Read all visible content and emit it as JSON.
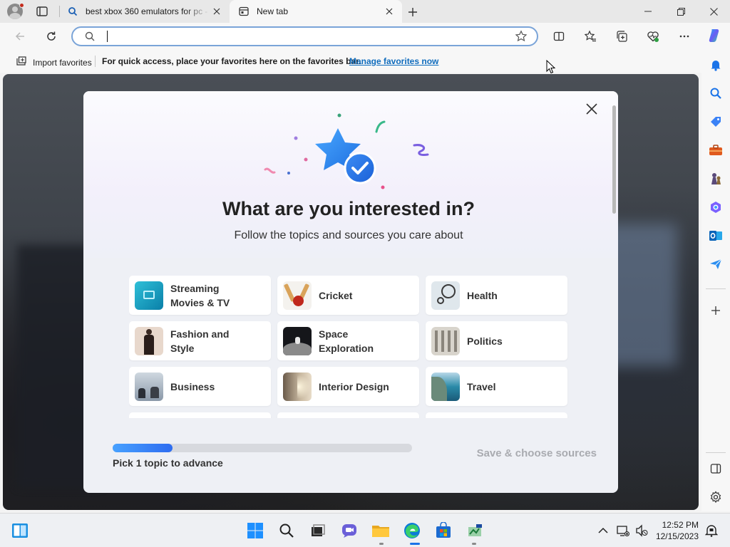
{
  "browser": {
    "tabs": [
      {
        "label": "best xbox 360 emulators for pc -",
        "icon": "search-icon",
        "active": false
      },
      {
        "label": "New tab",
        "icon": "newtab-page-icon",
        "active": true
      }
    ],
    "address_value": "",
    "favorites_bar": {
      "import_label": "Import favorites",
      "message": "For quick access, place your favorites here on the favorites bar.",
      "link_label": "Manage favorites now"
    }
  },
  "modal": {
    "title": "What are you interested in?",
    "subtitle": "Follow the topics and sources you care about",
    "topics": [
      {
        "line1": "Streaming",
        "line2": "Movies & TV",
        "icon": "streaming-thumb"
      },
      {
        "line1": "Cricket",
        "line2": "",
        "icon": "cricket-thumb"
      },
      {
        "line1": "Health",
        "line2": "",
        "icon": "health-thumb"
      },
      {
        "line1": "Fashion and",
        "line2": "Style",
        "icon": "fashion-thumb"
      },
      {
        "line1": "Space",
        "line2": "Exploration",
        "icon": "space-thumb"
      },
      {
        "line1": "Politics",
        "line2": "",
        "icon": "politics-thumb"
      },
      {
        "line1": "Business",
        "line2": "",
        "icon": "business-thumb"
      },
      {
        "line1": "Interior Design",
        "line2": "",
        "icon": "interior-thumb"
      },
      {
        "line1": "Travel",
        "line2": "",
        "icon": "travel-thumb"
      }
    ],
    "progress_fraction": 0.2,
    "progress_label": "Pick 1 topic to advance",
    "save_label": "Save & choose sources"
  },
  "taskbar": {
    "time": "12:52 PM",
    "date": "12/15/2023"
  },
  "colors": {
    "accent": "#0f6cbd",
    "progress_start": "#47a1ff",
    "progress_end": "#2e6cf0",
    "disabled_text": "#a9abb0"
  }
}
